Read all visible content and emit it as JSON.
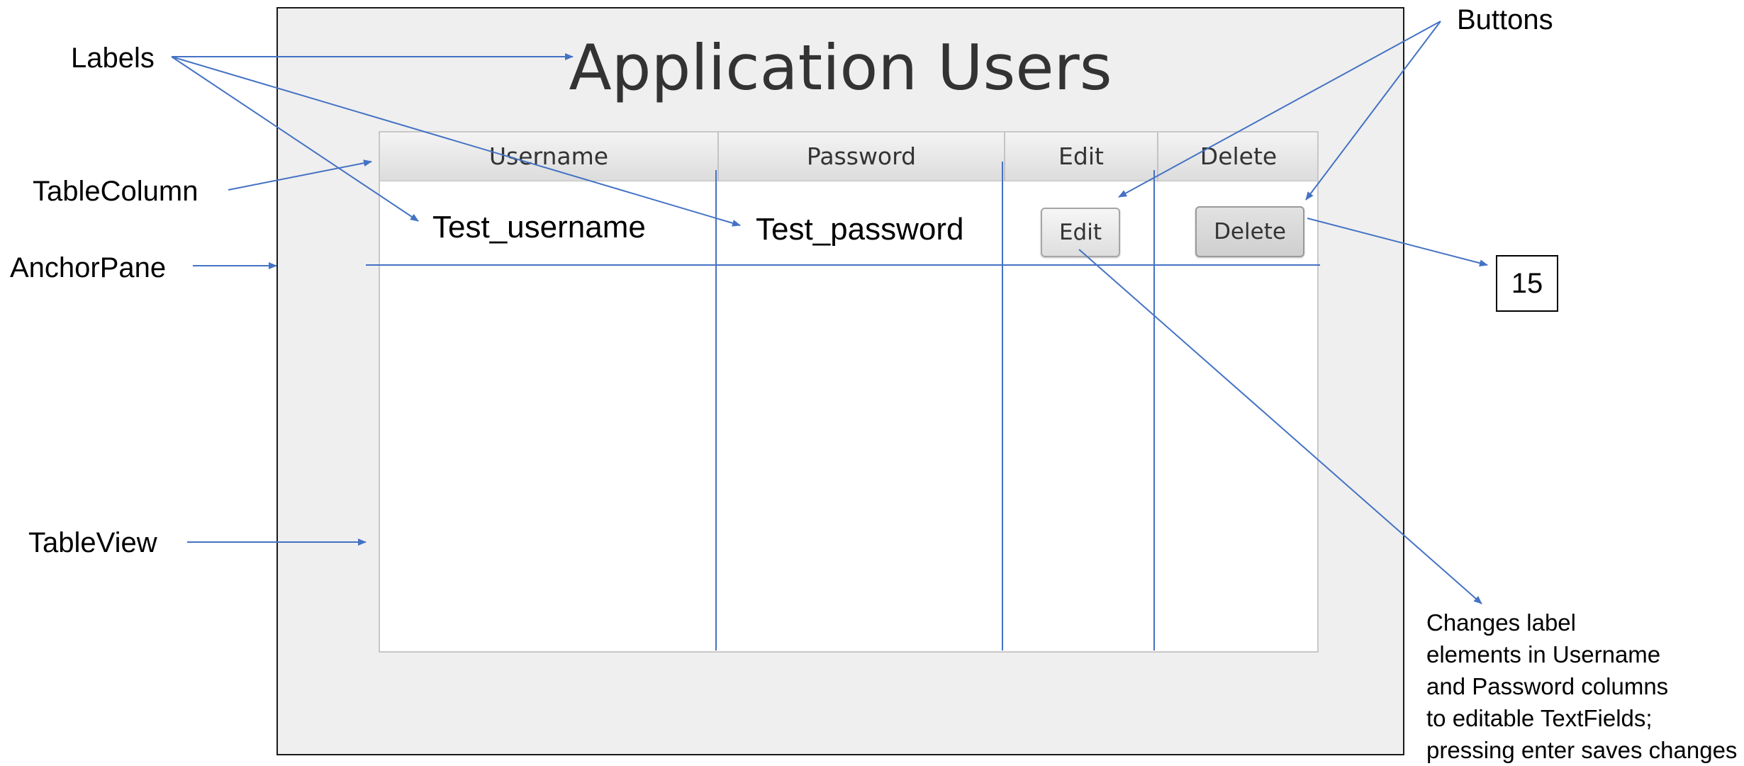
{
  "window": {
    "title": "Application Users"
  },
  "table": {
    "columns": [
      "Username",
      "Password",
      "Edit",
      "Delete"
    ],
    "rows": [
      {
        "username": "Test_username",
        "password": "Test_password",
        "edit_label": "Edit",
        "delete_label": "Delete"
      }
    ]
  },
  "annotations": {
    "labels": "Labels",
    "table_column": "TableColumn",
    "anchor_pane": "AnchorPane",
    "table_view": "TableView",
    "buttons": "Buttons",
    "count": "15",
    "edit_note": [
      "Changes label",
      "elements in Username",
      "and Password columns",
      "to editable TextFields;",
      "pressing enter saves changes"
    ]
  },
  "colors": {
    "arrow": "#4472c4",
    "pane_background": "#efefef",
    "title_text": "#333333"
  }
}
